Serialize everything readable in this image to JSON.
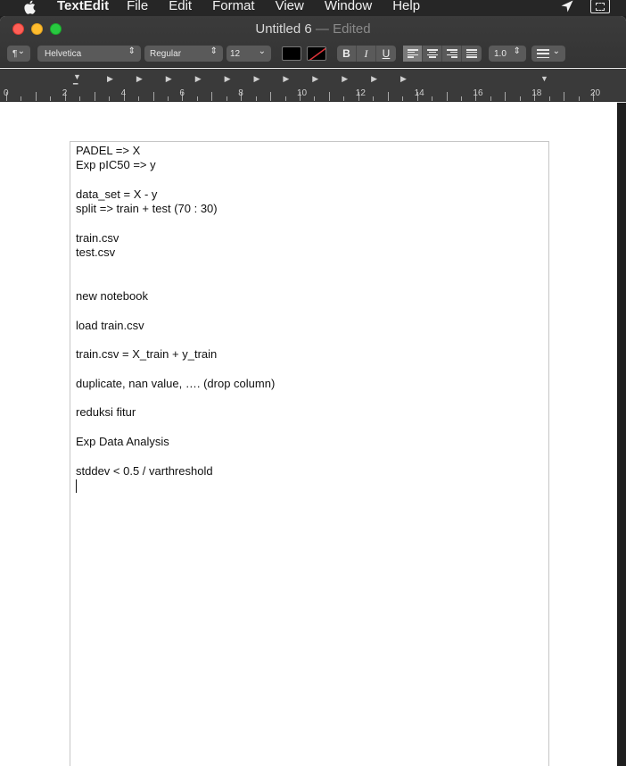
{
  "menubar": {
    "app_name": "TextEdit",
    "items": [
      "File",
      "Edit",
      "Format",
      "View",
      "Window",
      "Help"
    ]
  },
  "window": {
    "title": "Untitled 6",
    "separator": " — ",
    "status": "Edited"
  },
  "toolbar": {
    "paragraph_style": "¶",
    "font_family": "Helvetica",
    "font_style": "Regular",
    "font_size": "12",
    "bold": "B",
    "italic": "I",
    "underline": "U",
    "line_spacing": "1.0",
    "text_color": "#000000"
  },
  "ruler": {
    "numbers": [
      "0",
      "2",
      "4",
      "6",
      "8",
      "10",
      "12",
      "14",
      "16",
      "18",
      "20"
    ]
  },
  "document": {
    "lines": [
      "PADEL => X",
      "Exp pIC50 => y",
      "",
      "data_set = X - y",
      "split => train + test (70 : 30)",
      "",
      "train.csv",
      "test.csv",
      "",
      "",
      "new notebook",
      "",
      "load train.csv",
      "",
      "train.csv = X_train + y_train",
      "",
      "duplicate, nan value, …. (drop column)",
      "",
      "reduksi fitur",
      "",
      "Exp Data Analysis",
      "",
      "stddev < 0.5 / varthreshold"
    ]
  }
}
